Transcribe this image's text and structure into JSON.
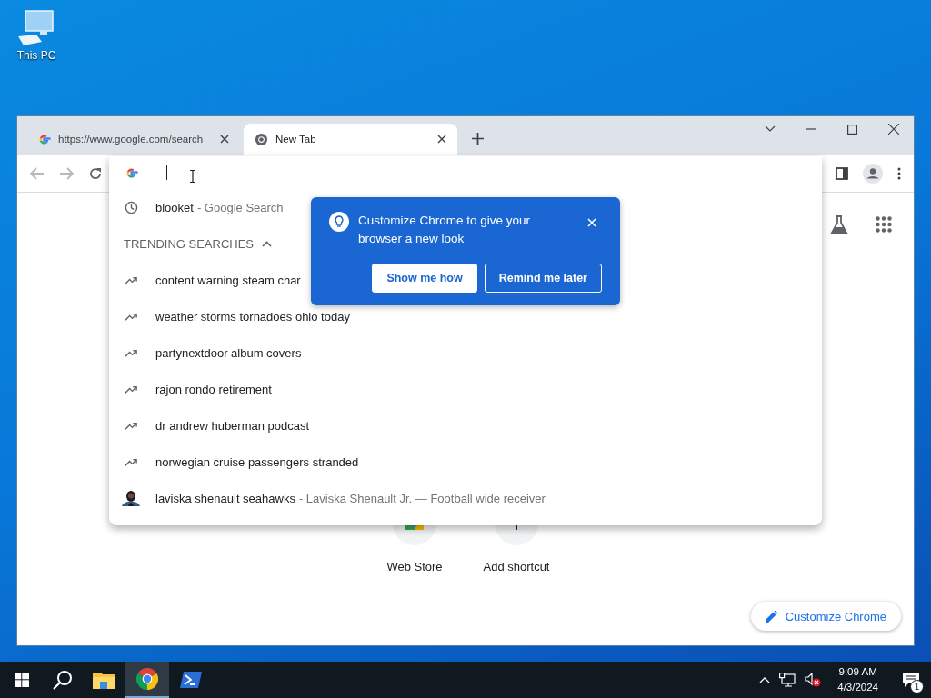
{
  "desktop": {
    "icons": [
      {
        "label": "This PC"
      }
    ]
  },
  "browser": {
    "tabs": [
      {
        "title": "https://www.google.com/search",
        "kind": "google",
        "selected": false
      },
      {
        "title": "New Tab",
        "kind": "chrome",
        "selected": true
      }
    ],
    "suggestions": [
      {
        "kind": "history",
        "text": "blooket",
        "description": "- Google Search"
      },
      {
        "kind": "heading",
        "text": "TRENDING SEARCHES",
        "expanded": true
      },
      {
        "kind": "trending",
        "text": "content warning steam char"
      },
      {
        "kind": "trending",
        "text": "weather storms tornadoes ohio today"
      },
      {
        "kind": "trending",
        "text": "partynextdoor album covers"
      },
      {
        "kind": "trending",
        "text": "rajon rondo retirement"
      },
      {
        "kind": "trending",
        "text": "dr andrew huberman podcast"
      },
      {
        "kind": "trending",
        "text": "norwegian cruise passengers stranded"
      },
      {
        "kind": "entity",
        "text": "laviska shenault seahawks",
        "description": "- Laviska Shenault Jr. — Football wide receiver"
      }
    ],
    "callout": {
      "title": "Customize Chrome to give your browser a new look",
      "buttons": [
        "Show me how",
        "Remind me later"
      ]
    },
    "shortcuts": [
      {
        "kind": "store",
        "label": "Web Store"
      },
      {
        "kind": "add",
        "label": "Add shortcut"
      }
    ],
    "customize_button": "Customize Chrome"
  },
  "taskbar": {
    "apps": [
      {
        "kind": "explorer",
        "selected": false
      },
      {
        "kind": "chrome",
        "selected": true
      },
      {
        "kind": "powershell",
        "selected": false
      }
    ],
    "time": "9:09 AM",
    "date": "4/3/2024",
    "notifications": "1"
  }
}
